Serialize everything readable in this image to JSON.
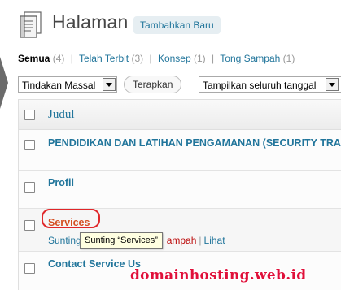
{
  "header": {
    "title": "Halaman",
    "add_new_label": "Tambahkan Baru"
  },
  "filters": {
    "all_label": "Semua",
    "all_count": "(4)",
    "published_label": "Telah Terbit",
    "published_count": "(3)",
    "draft_label": "Konsep",
    "draft_count": "(1)",
    "trash_label": "Tong Sampah",
    "trash_count": "(1)"
  },
  "tablenav": {
    "bulk_actions_value": "Tindakan Massal",
    "apply_label": "Terapkan",
    "date_filter_value": "Tampilkan seluruh tanggal"
  },
  "table": {
    "column_title": "Judul",
    "rows": [
      {
        "title": "PENDIDIKAN DAN LATIHAN PENGAMANAN (SECURITY TRA"
      },
      {
        "title": "Profil"
      },
      {
        "title": "Services"
      },
      {
        "title": "Contact Service Us"
      }
    ],
    "row_actions": {
      "edit_label": "Sunting",
      "trash_label": "ampah",
      "view_label": "Lihat"
    }
  },
  "tooltip": {
    "text": "Sunting “Services”"
  },
  "watermark": {
    "text": "domainhosting.web.id"
  }
}
